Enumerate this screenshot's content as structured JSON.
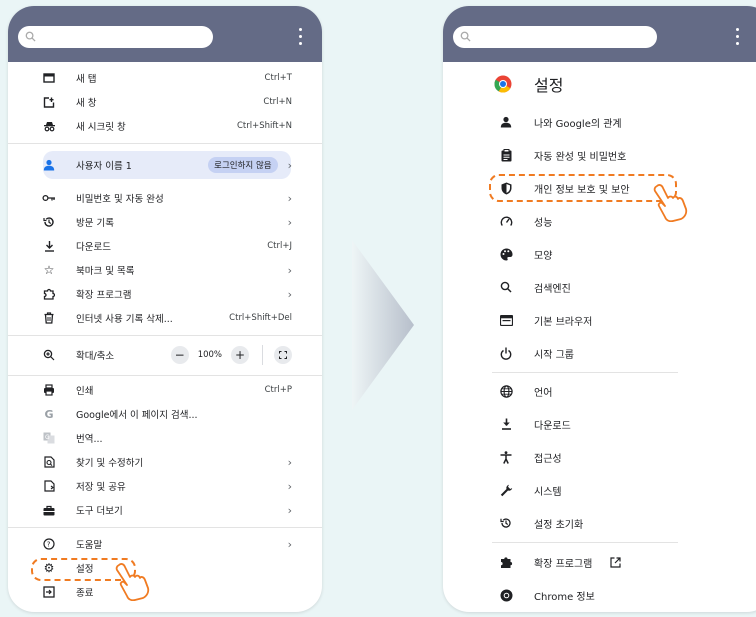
{
  "left_menu": {
    "items": [
      {
        "label": "새 탭",
        "shortcut": "Ctrl+T",
        "icon": "new-tab-icon"
      },
      {
        "label": "새 창",
        "shortcut": "Ctrl+N",
        "icon": "new-window-icon"
      },
      {
        "label": "새 시크릿 창",
        "shortcut": "Ctrl+Shift+N",
        "icon": "incognito-icon"
      },
      {
        "label": "사용자 이름 1",
        "badge": "로그인하지 않음",
        "icon": "person-icon"
      },
      {
        "label": "비밀번호 및 자동 완성",
        "icon": "key-icon"
      },
      {
        "label": "방문 기록",
        "icon": "history-icon"
      },
      {
        "label": "다운로드",
        "shortcut": "Ctrl+J",
        "icon": "download-icon"
      },
      {
        "label": "북마크 및 목록",
        "icon": "star-icon"
      },
      {
        "label": "확장 프로그램",
        "icon": "extension-icon"
      },
      {
        "label": "인터넷 사용 기록 삭제...",
        "shortcut": "Ctrl+Shift+Del",
        "icon": "trash-icon"
      },
      {
        "label": "확대/축소",
        "zoom": "100%",
        "icon": "zoom-icon"
      },
      {
        "label": "인쇄",
        "shortcut": "Ctrl+P",
        "icon": "print-icon"
      },
      {
        "label": "Google에서 이 페이지 검색...",
        "icon": "google-icon"
      },
      {
        "label": "번역...",
        "icon": "translate-icon"
      },
      {
        "label": "찾기 및 수정하기",
        "icon": "find-icon"
      },
      {
        "label": "저장 및 공유",
        "icon": "save-share-icon"
      },
      {
        "label": "도구 더보기",
        "icon": "toolbox-icon"
      },
      {
        "label": "도움말",
        "icon": "help-icon"
      },
      {
        "label": "설정",
        "icon": "gear-icon"
      },
      {
        "label": "종료",
        "icon": "exit-icon"
      }
    ],
    "zoom_minus": "−",
    "zoom_plus": "+"
  },
  "right_menu": {
    "title": "설정",
    "items": [
      {
        "label": "나와 Google의 관계",
        "icon": "person-icon"
      },
      {
        "label": "자동 완성 및 비밀번호",
        "icon": "clipboard-icon"
      },
      {
        "label": "개인 정보 보호 및 보안",
        "icon": "shield-icon"
      },
      {
        "label": "성능",
        "icon": "speedometer-icon"
      },
      {
        "label": "모양",
        "icon": "palette-icon"
      },
      {
        "label": "검색엔진",
        "icon": "search-icon"
      },
      {
        "label": "기본 브라우저",
        "icon": "browser-icon"
      },
      {
        "label": "시작 그룹",
        "icon": "power-icon"
      },
      {
        "label": "언어",
        "icon": "globe-icon"
      },
      {
        "label": "다운로드",
        "icon": "download-icon"
      },
      {
        "label": "접근성",
        "icon": "accessibility-icon"
      },
      {
        "label": "시스템",
        "icon": "wrench-icon"
      },
      {
        "label": "설정 초기화",
        "icon": "reset-icon"
      },
      {
        "label": "확장 프로그램",
        "icon": "extension-icon"
      },
      {
        "label": "Chrome 정보",
        "icon": "chrome-icon"
      }
    ]
  },
  "colors": {
    "topbar": "#646b86",
    "highlight": "#f07b22",
    "background": "#eaf5f6"
  }
}
